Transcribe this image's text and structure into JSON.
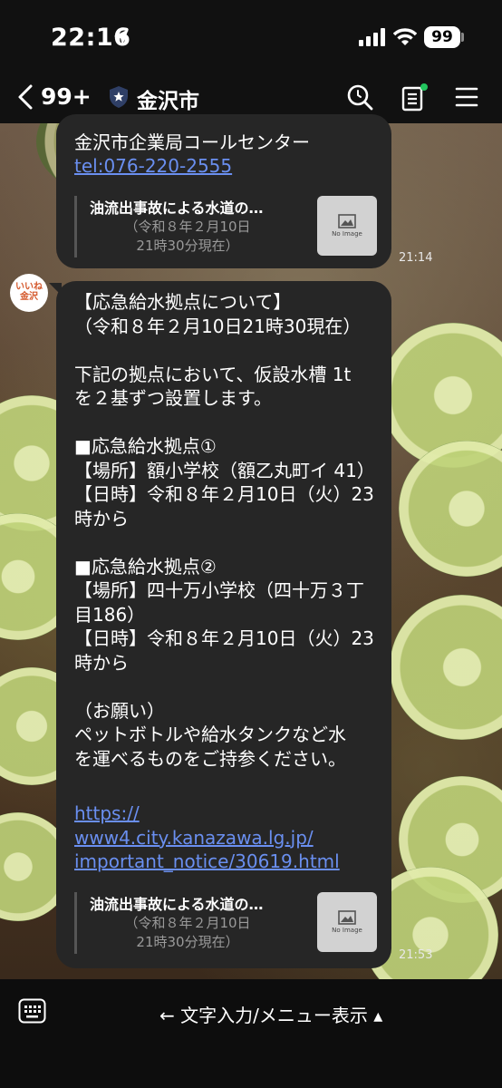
{
  "status": {
    "time": "22:16",
    "battery": "99"
  },
  "header": {
    "back_count": "99+",
    "title": "金沢市"
  },
  "messages": [
    {
      "lines": [
        "金沢市企業局コールセンター"
      ],
      "link": "tel:076-220-2555",
      "preview": {
        "title": "油流出事故による水道の…",
        "subtitle": "（令和８年２月10日\n21時30分現在）",
        "image_label": "No Image"
      },
      "time": "21:14"
    },
    {
      "text": "【応急給水拠点について】\n（令和８年２月10日21時30現在）\n\n下記の拠点において、仮設水槽 1t\nを２基ずつ設置します。\n\n■応急給水拠点①\n【場所】額小学校（額乙丸町イ 41）\n【日時】令和８年２月10日（火）23\n時から\n\n■応急給水拠点②\n【場所】四十万小学校（四十万３丁\n目186）\n【日時】令和８年２月10日（火）23\n時から\n\n（お願い）\nペットボトルや給水タンクなど水\nを運べるものをご持参ください。",
      "link": "https://\nwww4.city.kanazawa.lg.jp/\nimportant_notice/30619.html",
      "preview": {
        "title": "油流出事故による水道の…",
        "subtitle": "（令和８年２月10日\n21時30分現在）",
        "image_label": "No Image"
      },
      "time": "21:53"
    }
  ],
  "avatar": {
    "label": "いいね\n金沢"
  },
  "bottom": {
    "label": "← 文字入力/メニュー表示 ▴"
  },
  "icons": [
    "location-arrow-icon",
    "signal-icon",
    "wifi-icon",
    "back-chevron-icon",
    "shield-icon",
    "search-icon",
    "notes-icon",
    "menu-icon",
    "image-icon",
    "keyboard-icon"
  ],
  "colors": {
    "bubble": "#262626",
    "link": "#6a8ff0",
    "header": "#111111",
    "notification_dot": "#22c55e"
  }
}
